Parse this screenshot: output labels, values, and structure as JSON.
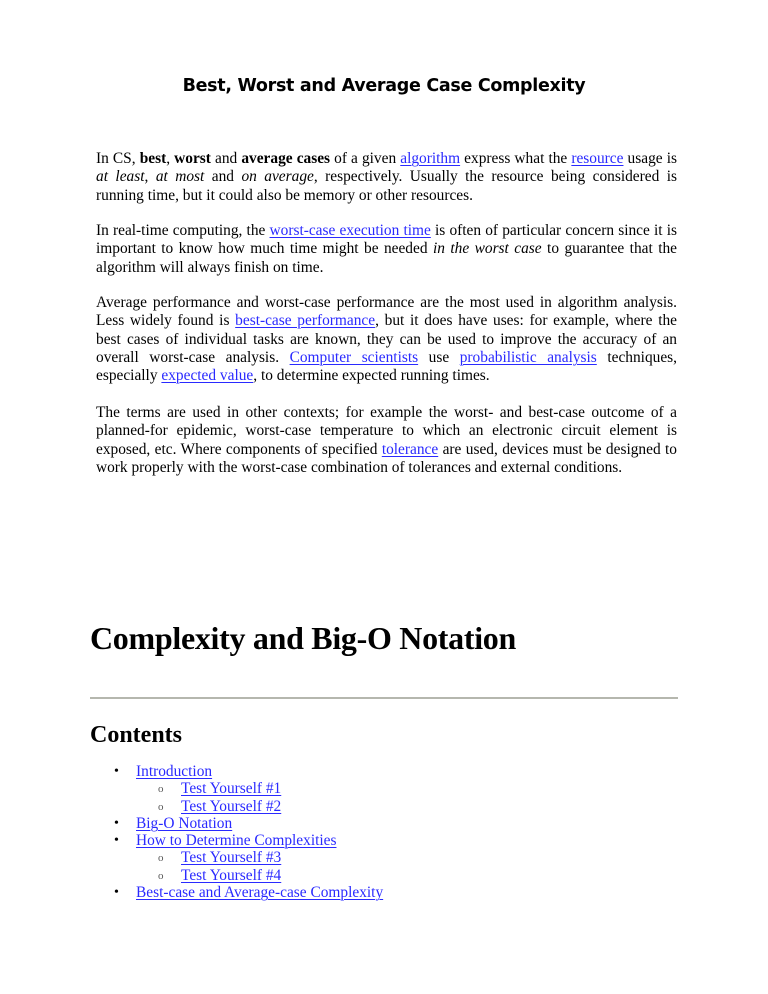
{
  "document": {
    "title": "Best, Worst and Average Case Complexity",
    "paragraphs": [
      {
        "segments": [
          {
            "text": "In CS, ",
            "style": "normal"
          },
          {
            "text": "best",
            "style": "bold"
          },
          {
            "text": ", ",
            "style": "normal"
          },
          {
            "text": "worst",
            "style": "bold"
          },
          {
            "text": " and ",
            "style": "normal"
          },
          {
            "text": "average cases",
            "style": "bold"
          },
          {
            "text": " of a given ",
            "style": "normal"
          },
          {
            "text": "algorithm",
            "style": "link"
          },
          {
            "text": " express what the ",
            "style": "normal"
          },
          {
            "text": "resource",
            "style": "link"
          },
          {
            "text": " usage is ",
            "style": "normal"
          },
          {
            "text": "at least",
            "style": "italic"
          },
          {
            "text": ", ",
            "style": "normal"
          },
          {
            "text": "at most",
            "style": "italic"
          },
          {
            "text": " and ",
            "style": "normal"
          },
          {
            "text": "on average",
            "style": "italic"
          },
          {
            "text": ", respectively. Usually the resource being considered is running time, but it could also be memory or other resources.",
            "style": "normal"
          }
        ]
      },
      {
        "segments": [
          {
            "text": "In real-time computing, the ",
            "style": "normal"
          },
          {
            "text": "worst-case execution time",
            "style": "link"
          },
          {
            "text": " is often of particular concern since it is important to know how much time might be needed ",
            "style": "normal"
          },
          {
            "text": "in the worst case",
            "style": "italic"
          },
          {
            "text": " to guarantee that the algorithm will always finish on time.",
            "style": "normal"
          }
        ]
      },
      {
        "segments": [
          {
            "text": "Average performance and worst-case performance are the most used in algorithm analysis. Less widely found is ",
            "style": "normal"
          },
          {
            "text": "best-case performance",
            "style": "link"
          },
          {
            "text": ", but it does have uses: for example, where the best cases of individual tasks are known, they can be used to improve the accuracy of an overall worst-case analysis. ",
            "style": "normal"
          },
          {
            "text": "Computer scientists",
            "style": "link"
          },
          {
            "text": " use ",
            "style": "normal"
          },
          {
            "text": "probabilistic analysis",
            "style": "link"
          },
          {
            "text": " techniques, especially ",
            "style": "normal"
          },
          {
            "text": "expected value",
            "style": "link"
          },
          {
            "text": ", to determine expected running times.",
            "style": "normal"
          }
        ]
      },
      {
        "segments": [
          {
            "text": "The terms are used in other contexts; for example the worst- and best-case outcome of a planned-for epidemic, worst-case temperature to which an electronic circuit element is exposed, etc. Where components of specified ",
            "style": "normal"
          },
          {
            "text": "tolerance",
            "style": "link"
          },
          {
            "text": " are used, devices must be designed to work properly with the worst-case combination of tolerances and external conditions.",
            "style": "normal"
          }
        ]
      }
    ]
  },
  "section": {
    "heading": "Complexity and Big-O Notation",
    "contents_heading": "Contents",
    "toc": [
      {
        "label": "Introduction",
        "level": 1
      },
      {
        "label": "Test Yourself #1",
        "level": 2
      },
      {
        "label": "Test Yourself #2",
        "level": 2
      },
      {
        "label": "Big-O Notation",
        "level": 1
      },
      {
        "label": "How to Determine Complexities",
        "level": 1
      },
      {
        "label": "Test Yourself #3",
        "level": 2
      },
      {
        "label": "Test Yourself #4",
        "level": 2
      },
      {
        "label": "Best-case and Average-case Complexity",
        "level": 1
      }
    ],
    "bullets": {
      "level1": "•",
      "level2": "o"
    }
  },
  "colors": {
    "link": "#2a2aff",
    "text": "#000000",
    "rule": "#b5b7ae"
  }
}
